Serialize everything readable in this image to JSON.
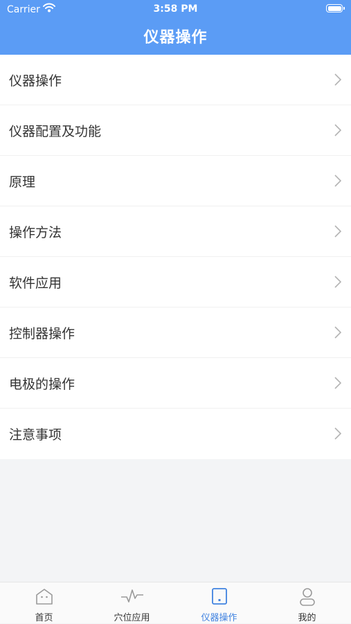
{
  "status_bar": {
    "carrier": "Carrier",
    "time": "3:58 PM"
  },
  "nav": {
    "title": "仪器操作"
  },
  "menu": {
    "items": [
      {
        "label": "仪器操作"
      },
      {
        "label": "仪器配置及功能"
      },
      {
        "label": "原理"
      },
      {
        "label": "操作方法"
      },
      {
        "label": "软件应用"
      },
      {
        "label": "控制器操作"
      },
      {
        "label": "电极的操作"
      },
      {
        "label": "注意事项"
      }
    ]
  },
  "tabbar": {
    "active_index": 2,
    "active_color": "#3f82e0",
    "tabs": [
      {
        "label": "首页",
        "icon": "home-icon"
      },
      {
        "label": "穴位应用",
        "icon": "pulse-icon"
      },
      {
        "label": "仪器操作",
        "icon": "device-icon"
      },
      {
        "label": "我的",
        "icon": "user-icon"
      }
    ]
  },
  "colors": {
    "nav_bg": "#5b9cf5",
    "page_bg": "#f3f4f6"
  }
}
